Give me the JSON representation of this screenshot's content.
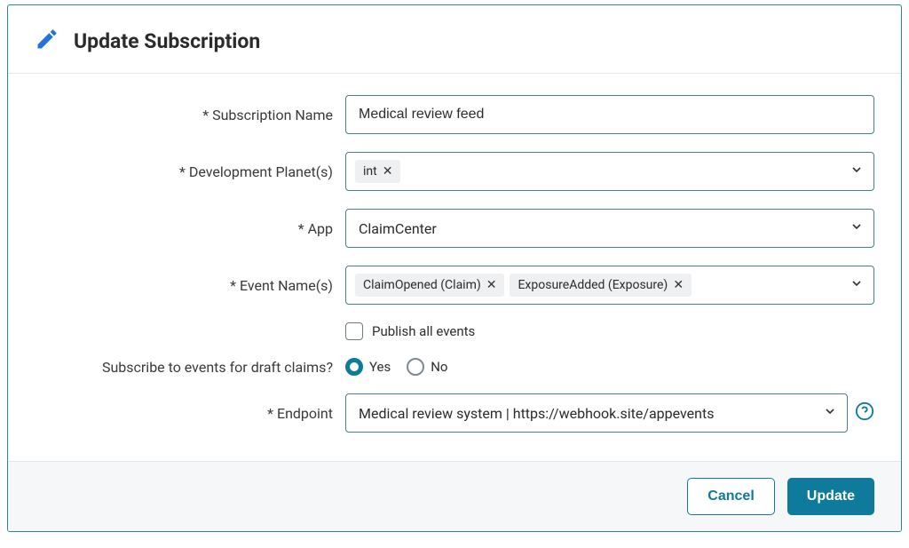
{
  "header": {
    "title": "Update Subscription"
  },
  "form": {
    "subscription_name": {
      "label": "* Subscription Name",
      "value": "Medical review feed"
    },
    "planets": {
      "label": "* Development Planet(s)",
      "chips": [
        "int"
      ]
    },
    "app": {
      "label": "* App",
      "value": "ClaimCenter"
    },
    "events": {
      "label": "* Event Name(s)",
      "chips": [
        "ClaimOpened (Claim)",
        "ExposureAdded (Exposure)"
      ]
    },
    "publish_all": {
      "label": "Publish all events",
      "checked": false
    },
    "draft_claims": {
      "label": "Subscribe to events for draft claims?",
      "options": {
        "yes": "Yes",
        "no": "No"
      },
      "selected": "yes"
    },
    "endpoint": {
      "label": "* Endpoint",
      "value": "Medical review system | https://webhook.site/appevents"
    }
  },
  "footer": {
    "cancel": "Cancel",
    "update": "Update"
  }
}
